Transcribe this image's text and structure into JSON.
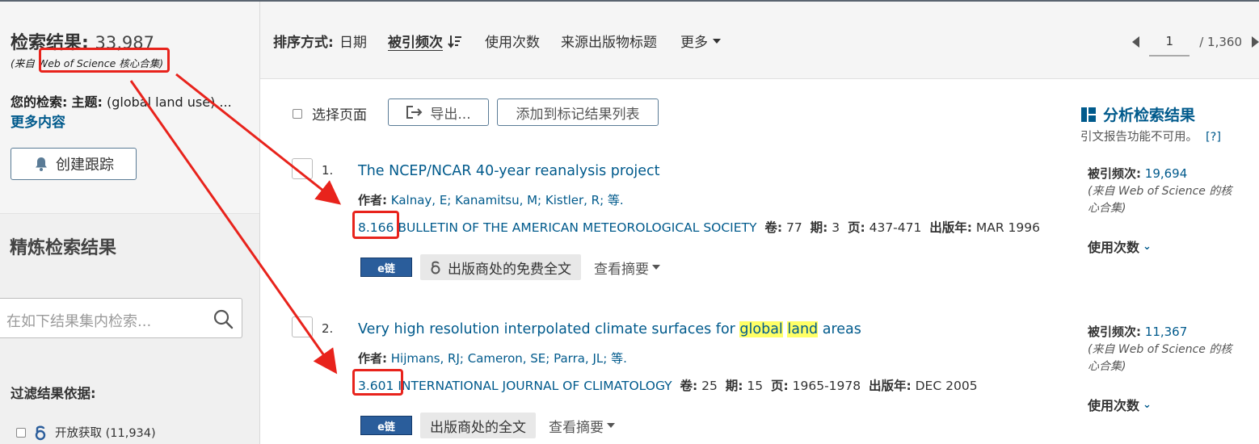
{
  "sidebar": {
    "results_label": "检索结果:",
    "results_count": "33,987",
    "source": "(来自 Web of Science 核心合集)",
    "your_search_label": "您的检索:",
    "topic_label": "主题:",
    "topic_value": "(global land use) ...",
    "more_link": "更多内容",
    "create_alert": "创建跟踪",
    "refine_title": "精炼检索结果",
    "refine_placeholder": "在如下结果集内检索...",
    "filter_title": "过滤结果依据:",
    "filter_open_access": "开放获取 (11,934)"
  },
  "sortbar": {
    "label": "排序方式:",
    "items": [
      "日期",
      "被引频次",
      "使用次数",
      "来源出版物标题",
      "更多"
    ],
    "page_current": "1",
    "page_total": "/ 1,360"
  },
  "toolbar": {
    "select_page": "选择页面",
    "export": "导出...",
    "add_marked": "添加到标记结果列表",
    "analyze": "分析检索结果",
    "citation_note": "引文报告功能不可用。",
    "help": "[?]"
  },
  "records": [
    {
      "num": "1.",
      "title": "The NCEP/NCAR 40-year reanalysis project",
      "authors_label": "作者:",
      "authors": "Kalnay, E; Kanamitsu, M; Kistler, R; 等.",
      "impact": "8.166",
      "journal": "BULLETIN OF THE AMERICAN METEOROLOGICAL SOCIETY",
      "vol_label": "卷:",
      "vol": "77",
      "issue_label": "期:",
      "issue": "3",
      "pages_label": "页:",
      "pages": "437-471",
      "year_label": "出版年:",
      "year": "MAR 1996",
      "elink": "e链",
      "fulltext": "出版商处的免费全文",
      "abstract": "查看摘要",
      "cited_label": "被引频次:",
      "cited": "19,694",
      "cited_src": "(来自 Web of Science 的核心合集)",
      "usage": "使用次数"
    },
    {
      "num": "2.",
      "title_pre": "Very high resolution interpolated climate surfaces for ",
      "title_hl1": "global",
      "title_sp": " ",
      "title_hl2": "land",
      "title_post": " areas",
      "authors_label": "作者:",
      "authors": "Hijmans, RJ; Cameron, SE; Parra, JL; 等.",
      "impact": "3.601",
      "journal": "INTERNATIONAL JOURNAL OF CLIMATOLOGY",
      "vol_label": "卷:",
      "vol": "25",
      "issue_label": "期:",
      "issue": "15",
      "pages_label": "页:",
      "pages": "1965-1978",
      "year_label": "出版年:",
      "year": "DEC 2005",
      "elink": "e链",
      "fulltext": "出版商处的全文",
      "abstract": "查看摘要",
      "cited_label": "被引频次:",
      "cited": "11,367",
      "cited_src": "(来自 Web of Science 的核心合集)",
      "usage": "使用次数"
    }
  ],
  "colors": {
    "link": "#005a8c",
    "annotation": "#e8231c",
    "highlight": "#ffff66"
  }
}
